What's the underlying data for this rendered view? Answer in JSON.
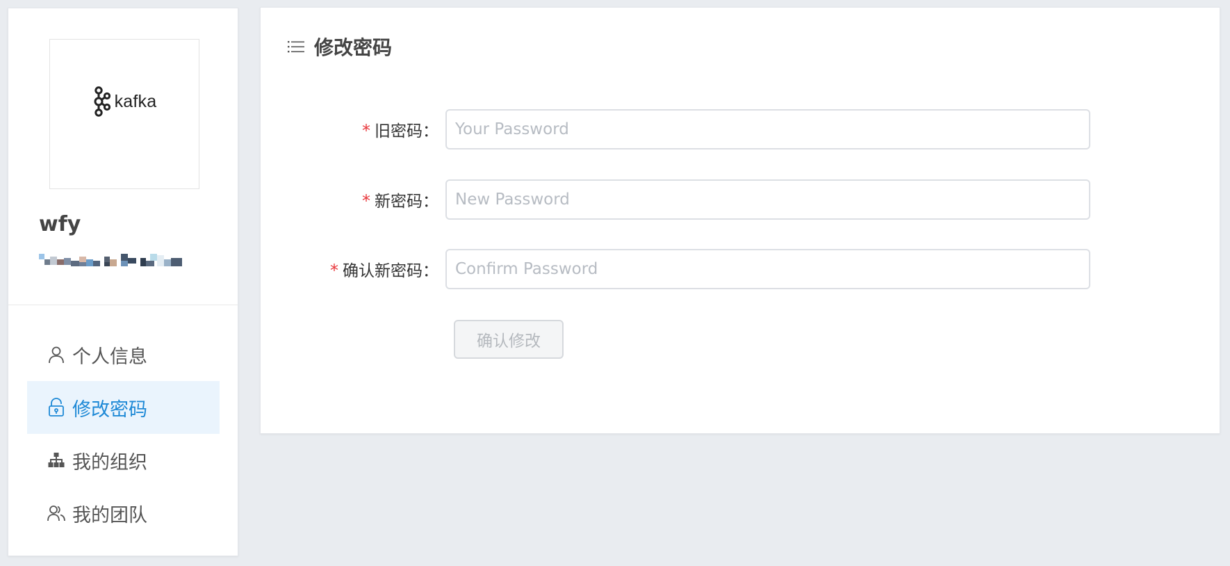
{
  "sidebar": {
    "logo_text": "kafka",
    "logo_icon": "kafka-logo-icon",
    "username": "wfy",
    "menu": [
      {
        "label": "个人信息",
        "icon": "user-icon",
        "active": false
      },
      {
        "label": "修改密码",
        "icon": "lock-icon",
        "active": true
      },
      {
        "label": "我的组织",
        "icon": "sitemap-icon",
        "active": false
      },
      {
        "label": "我的团队",
        "icon": "team-icon",
        "active": false
      }
    ]
  },
  "main": {
    "title": "修改密码",
    "title_icon": "list-icon",
    "form": {
      "old_password": {
        "label": "旧密码：",
        "placeholder": "Your Password",
        "value": ""
      },
      "new_password": {
        "label": "新密码：",
        "placeholder": "New Password",
        "value": ""
      },
      "confirm_password": {
        "label": "确认新密码：",
        "placeholder": "Confirm Password",
        "value": ""
      },
      "required_mark": "*",
      "submit_label": "确认修改"
    }
  },
  "colors": {
    "accent": "#1e89d6",
    "active_bg": "#eaf4fd",
    "required": "#e8383d",
    "page_bg": "#e9ecf0"
  }
}
